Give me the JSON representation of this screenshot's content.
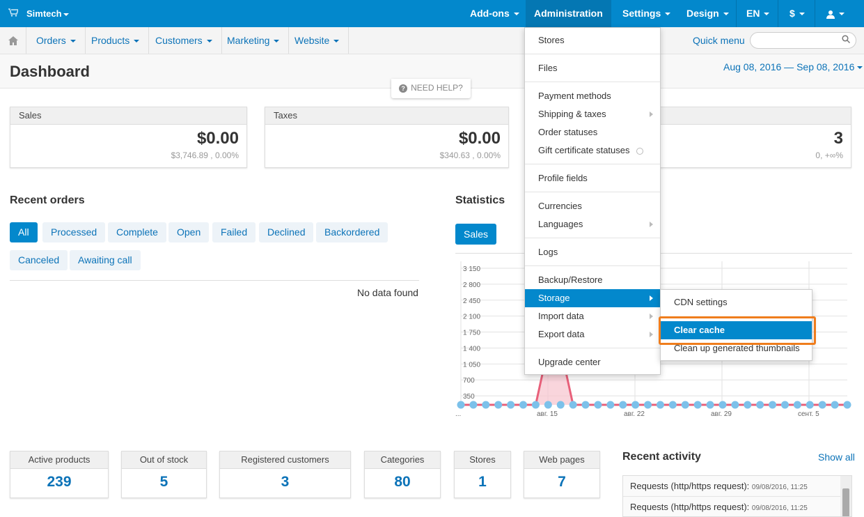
{
  "topbar": {
    "brand": "Simtech",
    "nav": [
      "Add-ons",
      "Administration",
      "Settings",
      "Design",
      "EN",
      "$"
    ]
  },
  "subnav": {
    "items": [
      "Orders",
      "Products",
      "Customers",
      "Marketing",
      "Website"
    ],
    "quick_menu": "Quick menu"
  },
  "page": {
    "title": "Dashboard",
    "date_range": "Aug 08, 2016 — Sep 08, 2016",
    "need_help": "NEED HELP?"
  },
  "cards": [
    {
      "title": "Sales",
      "value": "$0.00",
      "sub": "$3,746.89 , 0.00%"
    },
    {
      "title": "Taxes",
      "value": "$0.00",
      "sub": "$340.63 , 0.00%"
    },
    {
      "title": "",
      "value": "3",
      "sub": "0, +∞%"
    }
  ],
  "recent_orders": {
    "title": "Recent orders",
    "filters": [
      "All",
      "Processed",
      "Complete",
      "Open",
      "Failed",
      "Declined",
      "Backordered",
      "Canceled",
      "Awaiting call"
    ],
    "empty": "No data found"
  },
  "statistics": {
    "title": "Statistics",
    "tab": "Sales"
  },
  "chart_data": {
    "type": "line",
    "y_ticks": [
      "3 150",
      "2 800",
      "2 450",
      "2 100",
      "1 750",
      "1 400",
      "1 050",
      "700",
      "350"
    ],
    "x_ticks": [
      "...",
      "авг. 15",
      "авг. 22",
      "авг. 29",
      "сент. 5"
    ],
    "ylim": [
      0,
      3150
    ],
    "series": [
      {
        "values": [
          0,
          0,
          0,
          0,
          0,
          0,
          0,
          1250,
          1250,
          0,
          0,
          0,
          0,
          0,
          0,
          0,
          0,
          0,
          0,
          0,
          0,
          0,
          0,
          0,
          0,
          0,
          0,
          0,
          0,
          0,
          0,
          0
        ],
        "color": "#e8607a"
      }
    ],
    "grid": true
  },
  "stats": [
    {
      "label": "Active products",
      "value": "239"
    },
    {
      "label": "Out of stock",
      "value": "5"
    },
    {
      "label": "Registered customers",
      "value": "3"
    },
    {
      "label": "Categories",
      "value": "80"
    },
    {
      "label": "Stores",
      "value": "1"
    },
    {
      "label": "Web pages",
      "value": "7"
    }
  ],
  "recent_activity": {
    "title": "Recent activity",
    "show_all": "Show all",
    "rows": [
      {
        "text": "Requests (http/https request):",
        "time": "09/08/2016, 11:25"
      },
      {
        "text": "Requests (http/https request):",
        "time": "09/08/2016, 11:25"
      }
    ]
  },
  "admin_menu": {
    "items": [
      "Stores",
      "Files",
      "Payment methods",
      "Shipping & taxes",
      "Order statuses",
      "Gift certificate statuses",
      "Profile fields",
      "Currencies",
      "Languages",
      "Logs",
      "Backup/Restore",
      "Storage",
      "Import data",
      "Export data",
      "Upgrade center"
    ]
  },
  "storage_menu": {
    "items": [
      "CDN settings",
      "Clear cache",
      "Clean up generated thumbnails"
    ]
  },
  "colors": {
    "primary": "#0388cc",
    "link": "#0c73b8",
    "highlight": "#ef7d1d",
    "series": "#e8607a"
  }
}
